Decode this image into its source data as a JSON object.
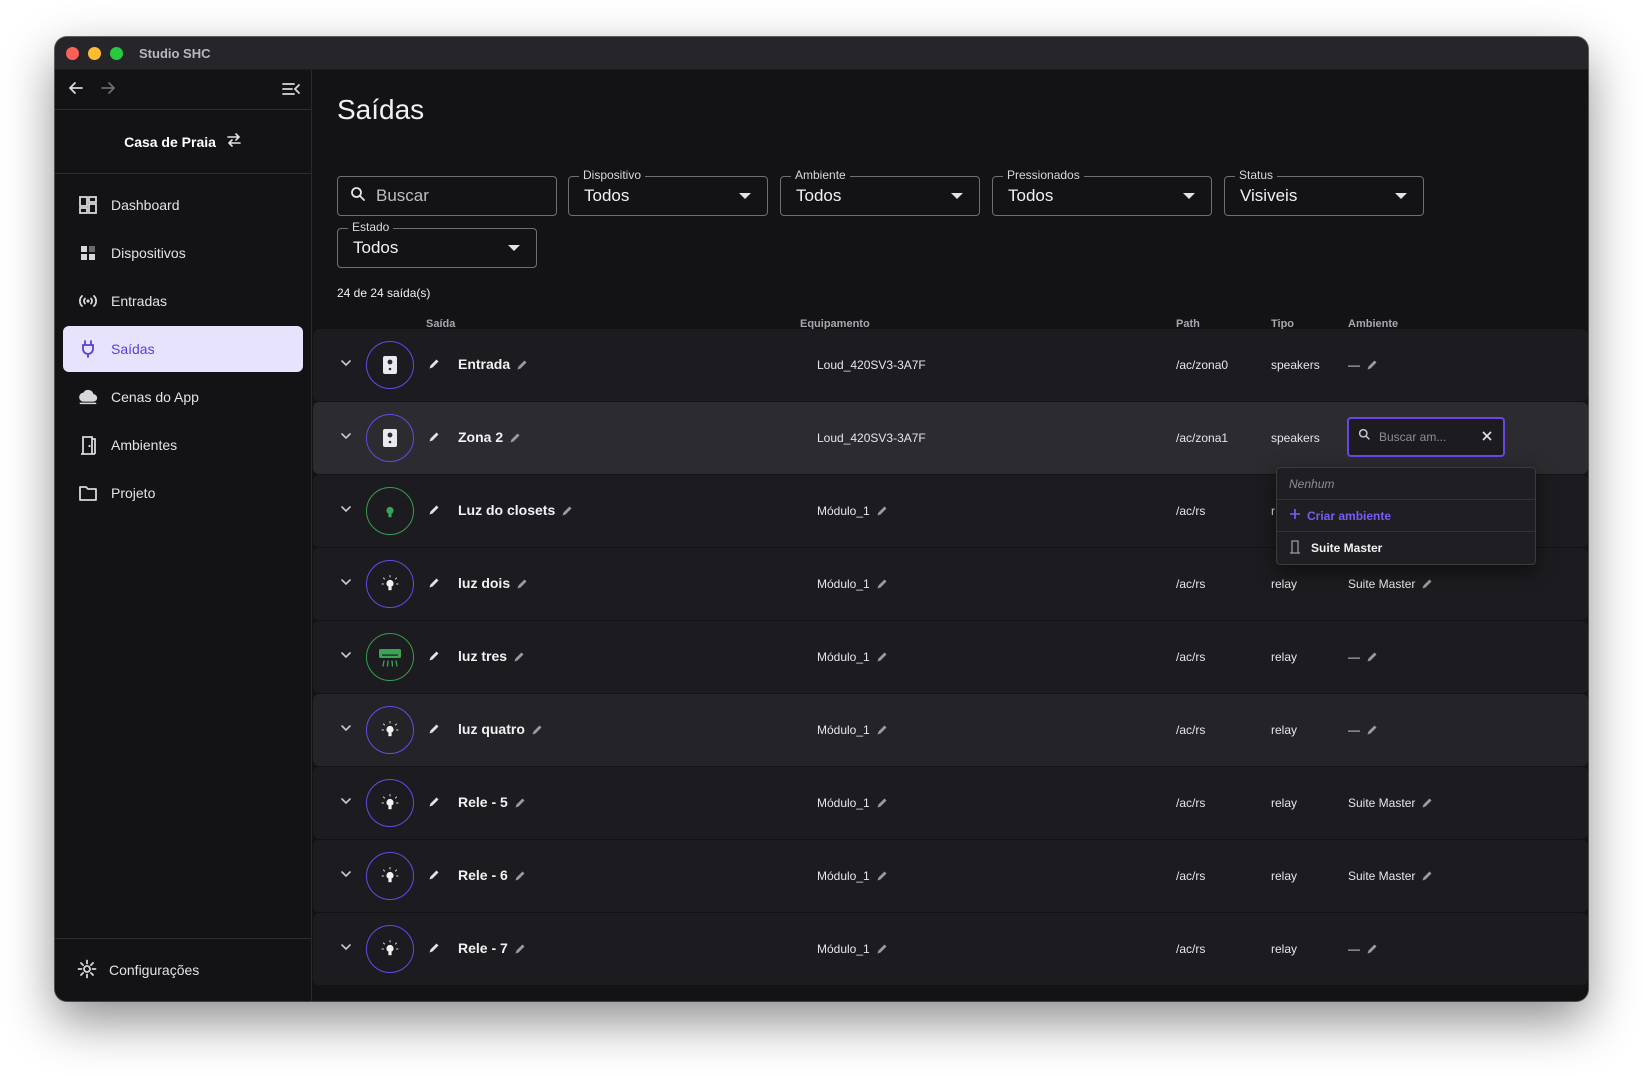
{
  "window": {
    "title": "Studio SHC"
  },
  "sidebar": {
    "project": "Casa de Praia",
    "items": [
      {
        "label": "Dashboard",
        "icon": "dashboard-icon",
        "active": false
      },
      {
        "label": "Dispositivos",
        "icon": "devices-icon",
        "active": false
      },
      {
        "label": "Entradas",
        "icon": "broadcast-icon",
        "active": false
      },
      {
        "label": "Saídas",
        "icon": "plug-icon",
        "active": true
      },
      {
        "label": "Cenas do App",
        "icon": "cloud-icon",
        "active": false
      },
      {
        "label": "Ambientes",
        "icon": "door-icon",
        "active": false
      },
      {
        "label": "Projeto",
        "icon": "folder-icon",
        "active": false
      }
    ],
    "footer": "Configurações"
  },
  "main": {
    "title": "Saídas",
    "search_placeholder": "Buscar",
    "filters": {
      "dispositivo": {
        "label": "Dispositivo",
        "value": "Todos"
      },
      "ambiente": {
        "label": "Ambiente",
        "value": "Todos"
      },
      "pressionados": {
        "label": "Pressionados",
        "value": "Todos"
      },
      "status": {
        "label": "Status",
        "value": "Visiveis"
      },
      "estado": {
        "label": "Estado",
        "value": "Todos"
      }
    },
    "count": "24 de 24 saída(s)",
    "columns": {
      "saida": "Saída",
      "equipamento": "Equipamento",
      "path": "Path",
      "tipo": "Tipo",
      "ambiente": "Ambiente"
    },
    "rows": [
      {
        "name": "Entrada",
        "equip": "Loud_420SV3-3A7F",
        "path": "/ac/zona0",
        "tipo": "speakers",
        "ambiente": "—",
        "icon": "speaker-icon"
      },
      {
        "name": "Zona 2",
        "equip": "Loud_420SV3-3A7F",
        "path": "/ac/zona1",
        "tipo": "speakers",
        "ambiente": "",
        "icon": "speaker-icon"
      },
      {
        "name": "Luz do closets",
        "equip": "Módulo_1",
        "path": "/ac/rs",
        "tipo": "r",
        "ambiente": "",
        "icon": "bulb-icon"
      },
      {
        "name": "luz dois",
        "equip": "Módulo_1",
        "path": "/ac/rs",
        "tipo": "relay",
        "ambiente": "Suite Master",
        "icon": "bulb-icon"
      },
      {
        "name": "luz tres",
        "equip": "Módulo_1",
        "path": "/ac/rs",
        "tipo": "relay",
        "ambiente": "—",
        "icon": "ac-icon"
      },
      {
        "name": "luz quatro",
        "equip": "Módulo_1",
        "path": "/ac/rs",
        "tipo": "relay",
        "ambiente": "—",
        "icon": "bulb-icon"
      },
      {
        "name": "Rele - 5",
        "equip": "Módulo_1",
        "path": "/ac/rs",
        "tipo": "relay",
        "ambiente": "Suite Master",
        "icon": "bulb-icon"
      },
      {
        "name": "Rele - 6",
        "equip": "Módulo_1",
        "path": "/ac/rs",
        "tipo": "relay",
        "ambiente": "Suite Master",
        "icon": "bulb-icon"
      },
      {
        "name": "Rele - 7",
        "equip": "Módulo_1",
        "path": "/ac/rs",
        "tipo": "relay",
        "ambiente": "—",
        "icon": "bulb-icon"
      }
    ],
    "ambiente_search": {
      "placeholder": "Buscar am..."
    },
    "dropdown": {
      "none": "Nenhum",
      "create": "Criar ambiente",
      "option": "Suite Master"
    }
  },
  "colors": {
    "accent": "#6a46e6",
    "active_bg": "#e8e3fd",
    "green": "#3a9b50"
  }
}
